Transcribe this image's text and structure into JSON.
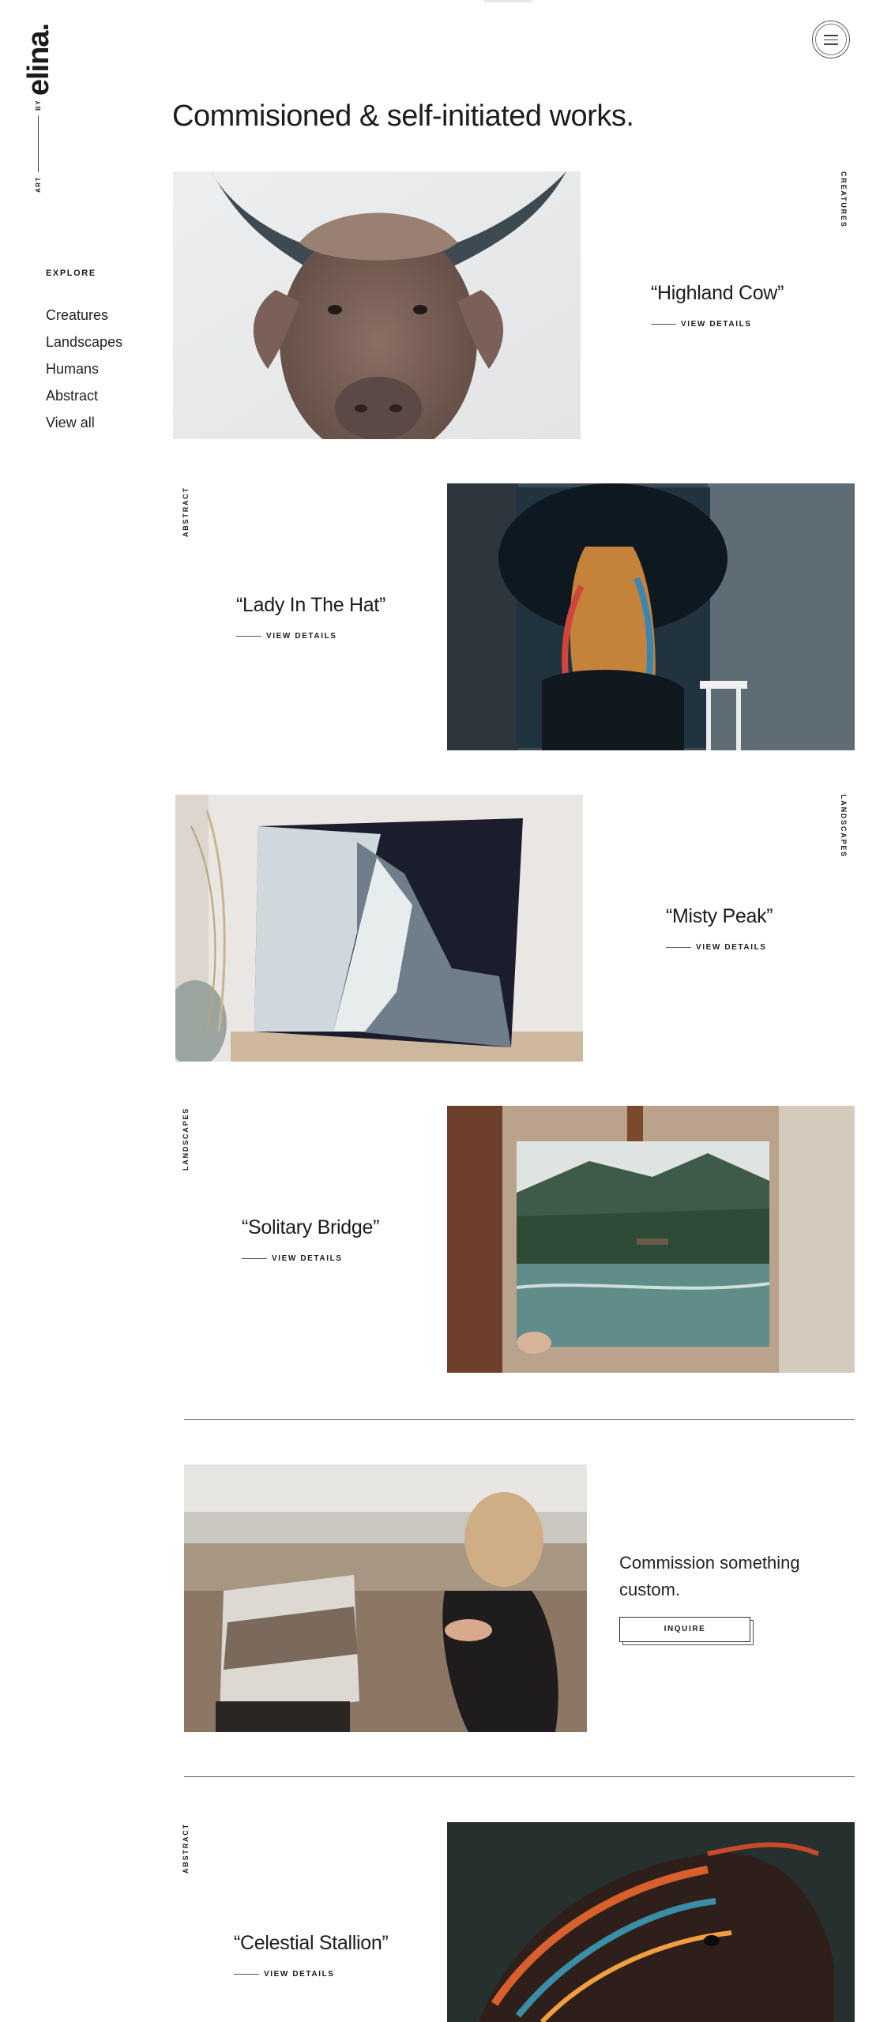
{
  "brand": {
    "name": "elina.",
    "by": "BY",
    "art": "ART"
  },
  "menu": {
    "label": "menu-icon"
  },
  "heading": "Commisioned & self-initiated works.",
  "explore": {
    "title": "EXPLORE",
    "items": [
      "Creatures",
      "Landscapes",
      "Humans",
      "Abstract",
      "View all"
    ]
  },
  "works": [
    {
      "title": "“Highland Cow”",
      "category": "CREATURES",
      "details": "VIEW DETAILS"
    },
    {
      "title": "“Lady In The Hat”",
      "category": "ABSTRACT",
      "details": "VIEW DETAILS"
    },
    {
      "title": "“Misty Peak”",
      "category": "LANDSCAPES",
      "details": "VIEW DETAILS"
    },
    {
      "title": "“Solitary Bridge”",
      "category": "LANDSCAPES",
      "details": "VIEW DETAILS"
    },
    {
      "title": "“Celestial Stallion”",
      "category": "ABSTRACT",
      "details": "VIEW DETAILS"
    }
  ],
  "commission": {
    "text": "Commission something custom.",
    "button": "INQUIRE"
  },
  "colors": {
    "text": "#1b1b1b",
    "background": "#ffffff",
    "rule": "#5a5a5a"
  }
}
